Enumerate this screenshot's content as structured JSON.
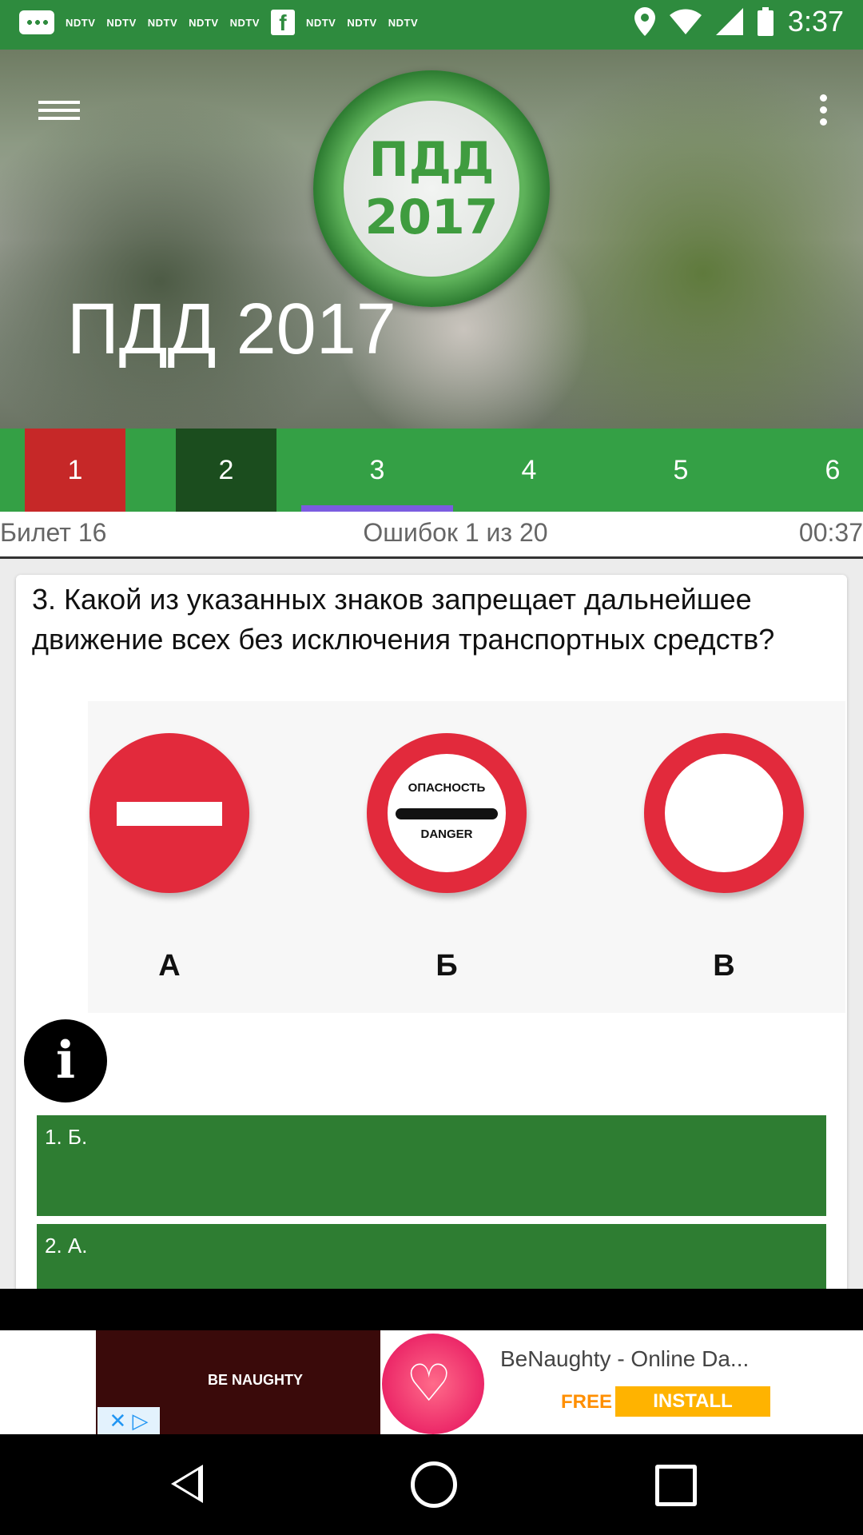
{
  "status_bar": {
    "notifications": [
      "NDTV",
      "NDTV",
      "NDTV",
      "NDTV",
      "NDTV",
      "NDTV",
      "NDTV",
      "NDTV"
    ],
    "time": "3:37"
  },
  "header": {
    "logo_line1": "ПДД",
    "logo_line2": "2017",
    "app_title": "ПДД 2017"
  },
  "tabs": [
    {
      "label": "1",
      "state": "wrong"
    },
    {
      "label": "2",
      "state": "correct"
    },
    {
      "label": "3",
      "state": "active"
    },
    {
      "label": "4",
      "state": "default"
    },
    {
      "label": "5",
      "state": "default"
    },
    {
      "label": "6",
      "state": "default"
    }
  ],
  "info_bar": {
    "ticket": "Билет 16",
    "errors": "Ошибок 1 из 20",
    "timer": "00:37"
  },
  "question": {
    "text": "3. Какой из указанных знаков запрещает дальнейшее движение всех без исключения транспортных средств?",
    "signs": [
      {
        "letter": "А"
      },
      {
        "letter": "Б",
        "text_top": "ОПАСНОСТЬ",
        "text_bottom": "DANGER"
      },
      {
        "letter": "В"
      }
    ]
  },
  "answers": [
    {
      "label": "1. Б."
    },
    {
      "label": "2. А."
    }
  ],
  "ad": {
    "brand": "BE NAUGHTY",
    "title": "BeNaughty - Online Da...",
    "free": "FREE",
    "install": "INSTALL"
  },
  "colors": {
    "primary": "#34a045",
    "wrong_tab": "#c62828",
    "correct_tab": "#1b4d1e",
    "indicator": "#7b5ce0",
    "answer_bg": "#2e7d32"
  }
}
